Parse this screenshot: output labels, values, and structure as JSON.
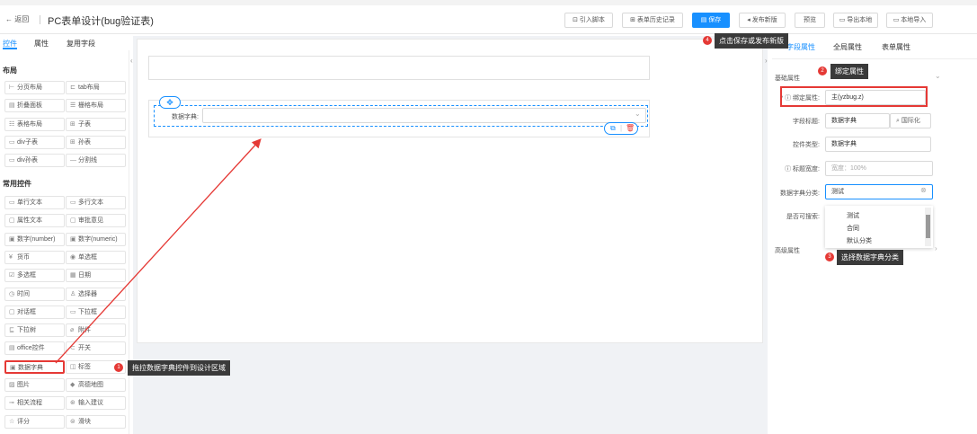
{
  "header": {
    "back_label": "← 返回",
    "title": "PC表单设计(bug验证表)",
    "buttons": [
      "引入脚本",
      "表单历史记录",
      "保存",
      "发布新版",
      "预览",
      "导出本地",
      "本地导入"
    ]
  },
  "left_panel": {
    "tabs": [
      "控件",
      "属性",
      "复用字段"
    ],
    "layout_title": "布局",
    "layout_items": [
      {
        "icon": "⊢",
        "label": "分页布局"
      },
      {
        "icon": "⊏",
        "label": "tab布局"
      },
      {
        "icon": "▤",
        "label": "折叠面板"
      },
      {
        "icon": "☰",
        "label": "栅格布局"
      },
      {
        "icon": "☷",
        "label": "表格布局"
      },
      {
        "icon": "⊞",
        "label": "子表"
      },
      {
        "icon": "▭",
        "label": "div子表"
      },
      {
        "icon": "⊞",
        "label": "孙表"
      },
      {
        "icon": "▭",
        "label": "div孙表"
      },
      {
        "icon": "—",
        "label": "分割线"
      }
    ],
    "common_title": "常用控件",
    "common_items": [
      {
        "icon": "▭",
        "label": "单行文本"
      },
      {
        "icon": "▭",
        "label": "多行文本"
      },
      {
        "icon": "▢",
        "label": "属性文本"
      },
      {
        "icon": "▢",
        "label": "审批意见"
      },
      {
        "icon": "▣",
        "label": "数字(number)"
      },
      {
        "icon": "▣",
        "label": "数字(numeric)"
      },
      {
        "icon": "¥",
        "label": "货币"
      },
      {
        "icon": "◉",
        "label": "单选框"
      },
      {
        "icon": "☑",
        "label": "多选框"
      },
      {
        "icon": "▦",
        "label": "日期"
      },
      {
        "icon": "◷",
        "label": "时间"
      },
      {
        "icon": "♙",
        "label": "选择器"
      },
      {
        "icon": "▢",
        "label": "对话框"
      },
      {
        "icon": "▭",
        "label": "下拉框"
      },
      {
        "icon": "⊑",
        "label": "下拉树"
      },
      {
        "icon": "⌀",
        "label": "附件"
      },
      {
        "icon": "▤",
        "label": "office控件"
      },
      {
        "icon": "⊂",
        "label": "开关"
      },
      {
        "icon": "▣",
        "label": "数据字典"
      },
      {
        "icon": "◫",
        "label": "标签"
      },
      {
        "icon": "▨",
        "label": "图片"
      },
      {
        "icon": "◆",
        "label": "高德地图"
      },
      {
        "icon": "⊸",
        "label": "相关流程"
      },
      {
        "icon": "⊛",
        "label": "输入建议"
      },
      {
        "icon": "☆",
        "label": "评分"
      },
      {
        "icon": "⊜",
        "label": "滑块"
      }
    ]
  },
  "canvas": {
    "field_label": "数据字典:"
  },
  "right_panel": {
    "tabs": [
      "字段属性",
      "全局属性",
      "表单属性"
    ],
    "basic_section": "基础属性",
    "rows": [
      {
        "label": "* ⓘ 绑定属性:",
        "value": "主(yzbug.z)"
      },
      {
        "label": "字段标题:",
        "value": "数据字典"
      },
      {
        "label": "控件类型:",
        "value": "数据字典"
      },
      {
        "label": "ⓘ 标题宽度:",
        "value": "宽度：100%"
      },
      {
        "label": "数据字典分类:",
        "value": "测试"
      },
      {
        "label": "是否可搜索:",
        "value": ""
      }
    ],
    "i18n_button": "国际化",
    "dropdown_options": [
      "测试",
      "合同",
      "默认分类"
    ],
    "advanced_section": "高级属性"
  },
  "annotations": [
    {
      "num": "1",
      "text": "拖拉数据字典控件到设计区域"
    },
    {
      "num": "2",
      "text": "绑定属性"
    },
    {
      "num": "3",
      "text": "选择数据字典分类"
    },
    {
      "num": "4",
      "text": "点击保存或发布新版"
    }
  ],
  "colors": {
    "accent": "#1890ff",
    "annotation": "#e53935",
    "tooltip": "#3a3a3a"
  }
}
